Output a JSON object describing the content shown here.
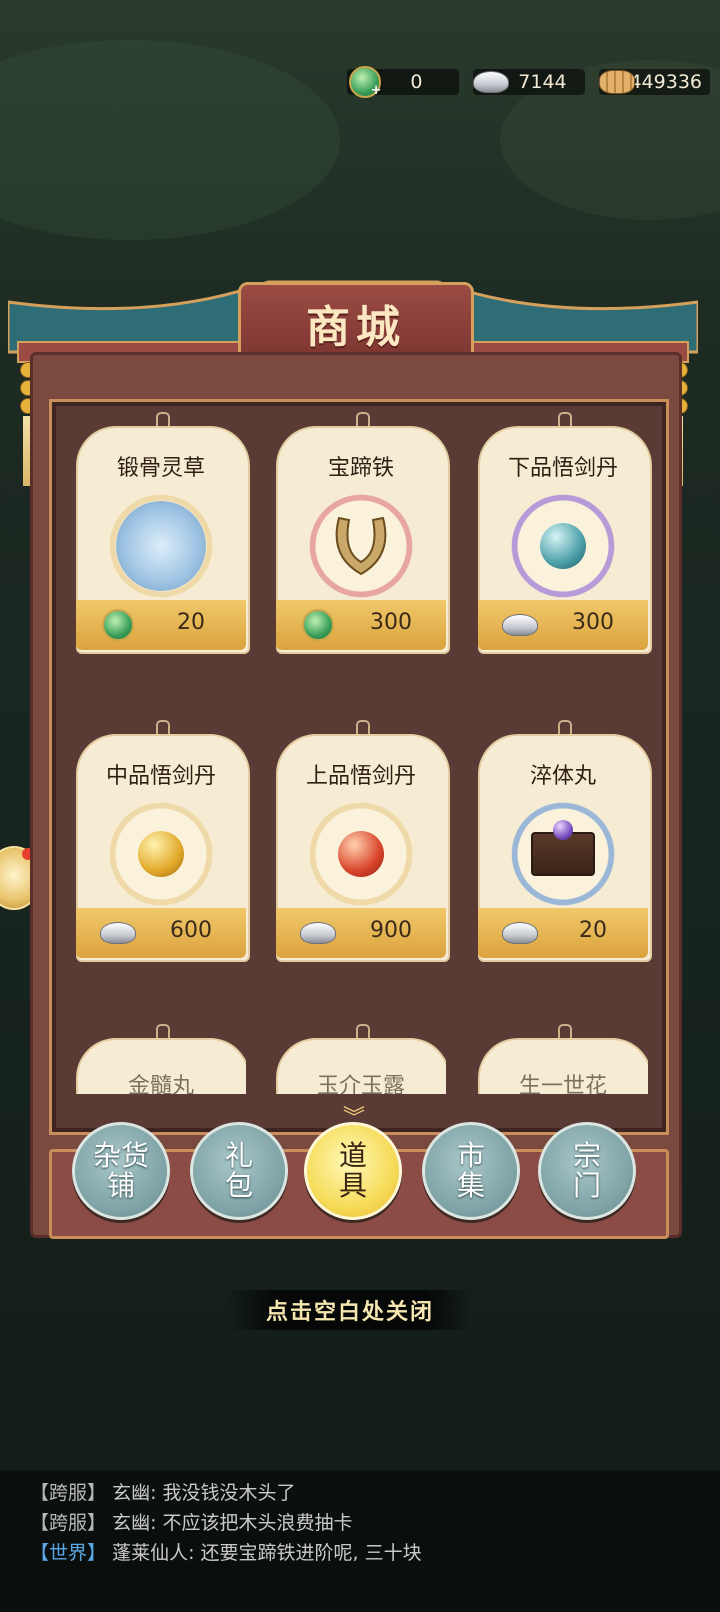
{
  "currency": {
    "jade": "0",
    "silver": "7144",
    "coins": "449336"
  },
  "shop": {
    "title": "商城",
    "items": [
      {
        "name": "锻骨灵草",
        "currency": "jade",
        "price": "20"
      },
      {
        "name": "宝蹄铁",
        "currency": "jade",
        "price": "300"
      },
      {
        "name": "下品悟剑丹",
        "currency": "silver",
        "price": "300"
      },
      {
        "name": "中品悟剑丹",
        "currency": "silver",
        "price": "600"
      },
      {
        "name": "上品悟剑丹",
        "currency": "silver",
        "price": "900"
      },
      {
        "name": "淬体丸",
        "currency": "silver",
        "price": "20"
      }
    ],
    "partial_items": [
      "金髓丸",
      "玉介玉露",
      "生一世花"
    ],
    "tabs": [
      {
        "label": "杂货铺",
        "active": false
      },
      {
        "label": "礼包",
        "active": false
      },
      {
        "label": "道具",
        "active": true
      },
      {
        "label": "市集",
        "active": false
      },
      {
        "label": "宗门",
        "active": false
      }
    ]
  },
  "close_hint": "点击空白处关闭",
  "chat": [
    {
      "channel": "【跨服】",
      "sender": "玄幽",
      "text": "我没钱没木头了"
    },
    {
      "channel": "【跨服】",
      "sender": "玄幽",
      "text": "不应该把木头浪费抽卡"
    },
    {
      "channel": "【世界】",
      "sender": "蓬莱仙人",
      "text": "还要宝蹄铁进阶呢, 三十块"
    }
  ]
}
